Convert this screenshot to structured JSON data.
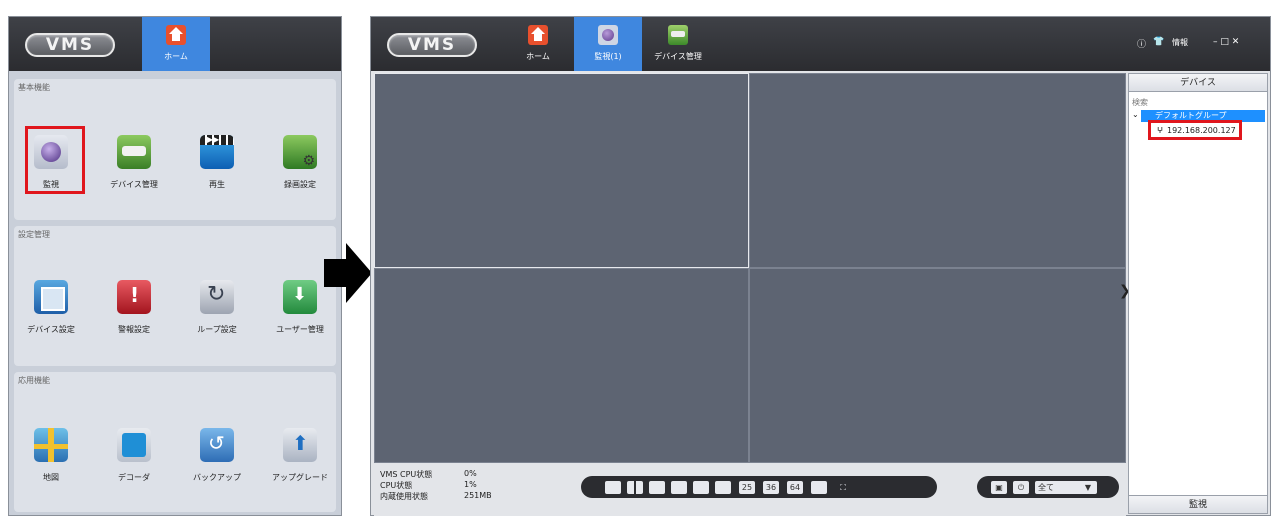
{
  "left_window": {
    "logo": "VMS",
    "nav": [
      {
        "label": "ホーム",
        "icon": "home-icon"
      }
    ],
    "sections": [
      {
        "title": "基本機能",
        "items": [
          {
            "label": "監視",
            "icon": "monitor-icon"
          },
          {
            "label": "デバイス管理",
            "icon": "device-manage-icon"
          },
          {
            "label": "再生",
            "icon": "playback-icon"
          },
          {
            "label": "録画設定",
            "icon": "record-settings-icon"
          }
        ]
      },
      {
        "title": "設定管理",
        "items": [
          {
            "label": "デバイス設定",
            "icon": "device-settings-icon"
          },
          {
            "label": "警報設定",
            "icon": "alarm-settings-icon"
          },
          {
            "label": "ループ設定",
            "icon": "loop-settings-icon"
          },
          {
            "label": "ユーザー管理",
            "icon": "user-manage-icon"
          }
        ]
      },
      {
        "title": "応用機能",
        "items": [
          {
            "label": "地図",
            "icon": "map-icon"
          },
          {
            "label": "デコーダ",
            "icon": "decoder-icon"
          },
          {
            "label": "バックアップ",
            "icon": "backup-icon"
          },
          {
            "label": "アップグレード",
            "icon": "upgrade-icon"
          }
        ]
      }
    ]
  },
  "right_window": {
    "logo": "VMS",
    "nav": [
      {
        "label": "ホーム",
        "icon": "home-icon"
      },
      {
        "label": "監視(1)",
        "icon": "monitor-icon"
      },
      {
        "label": "デバイス管理",
        "icon": "device-manage-icon"
      }
    ],
    "info_label": "情報",
    "window_controls": "– □ ✕",
    "status": {
      "vms_cpu_label": "VMS CPU状態",
      "vms_cpu_value": "0%",
      "cpu_label": "CPU状態",
      "cpu_value": "1%",
      "mem_label": "内蔵使用状態",
      "mem_value": "251MB"
    },
    "layout_buttons": [
      "25",
      "36",
      "64"
    ],
    "stream_select": {
      "value": "全て"
    },
    "device_panel": {
      "title": "デバイス",
      "search_placeholder": "検索",
      "group": "デフォルトグループ",
      "device_ip": "192.168.200.127",
      "footer": "監視"
    }
  },
  "colors": {
    "highlight": "#e0161d",
    "accent": "#3f87df",
    "video_bg": "#5d6472"
  }
}
